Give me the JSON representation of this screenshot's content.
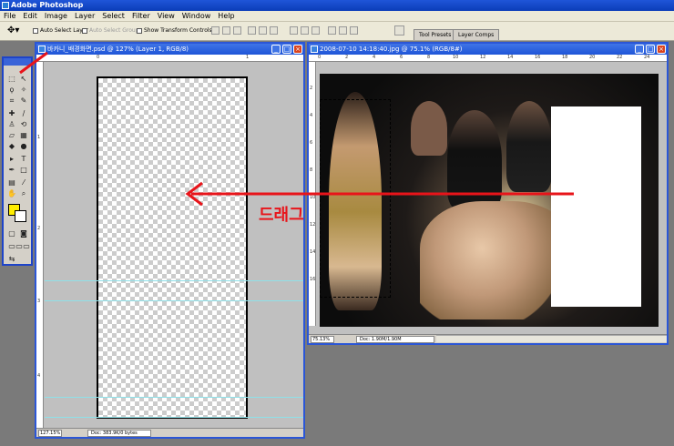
{
  "app": {
    "title": "Adobe Photoshop"
  },
  "menu": [
    "File",
    "Edit",
    "Image",
    "Layer",
    "Select",
    "Filter",
    "View",
    "Window",
    "Help"
  ],
  "options": {
    "auto_select_layer": "Auto Select Layer",
    "auto_select_groups": "Auto Select Groups",
    "show_transform_controls": "Show Transform Controls"
  },
  "wells": {
    "tool_presets": "Tool Presets",
    "layer_comps": "Layer Comps"
  },
  "doc_left": {
    "title": "바카니_배경화면.psd @ 127% (Layer 1, RGB/8)",
    "zoom": "127.15%",
    "doc_info": "Doc: 383.9K/0 bytes",
    "ruler_h": [
      "0",
      "1"
    ],
    "ruler_v": [
      "1",
      "2",
      "3",
      "4"
    ]
  },
  "doc_right": {
    "title": "2008-07-10 14:18:40.jpg @ 75.1% (RGB/8#)",
    "zoom": "75.13%",
    "doc_info": "Doc: 1.90M/1.90M",
    "ruler_h": [
      "0",
      "2",
      "4",
      "6",
      "8",
      "10",
      "12",
      "14",
      "16",
      "18",
      "20",
      "22",
      "24"
    ],
    "ruler_v": [
      "2",
      "4",
      "6",
      "8",
      "10",
      "12",
      "14",
      "16"
    ]
  },
  "annotation": {
    "drag_label": "드래그",
    "color": "#e8141a"
  },
  "colors": {
    "foreground": "#ffee00",
    "background": "#ffffff"
  }
}
